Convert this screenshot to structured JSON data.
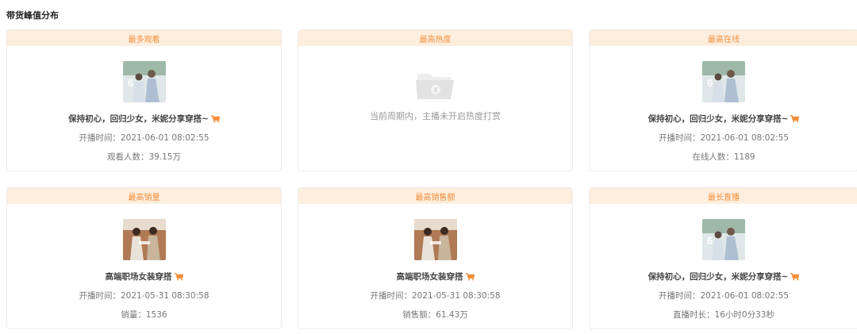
{
  "section_title": "带货峰值分布",
  "cards": [
    {
      "header": "最多观看",
      "title": "保持初心，回归少女，米妮分享穿搭~",
      "time": "开播时间：2021-06-01 08:02:55",
      "stat": "观看人数：39.15万"
    },
    {
      "header": "最高热度",
      "empty_text": "当前周期内，主播未开启热度打赏"
    },
    {
      "header": "最高在线",
      "title": "保持初心，回归少女，米妮分享穿搭~",
      "time": "开播时间：2021-06-01 08:02:55",
      "stat": "在线人数：1189"
    },
    {
      "header": "最高销量",
      "title": "高端职场女装穿搭",
      "time": "开播时间：2021-05-31 08:30:58",
      "stat": "销量：1536"
    },
    {
      "header": "最高销售额",
      "title": "高端职场女装穿搭",
      "time": "开播时间：2021-05-31 08:30:58",
      "stat": "销售额：61.43万"
    },
    {
      "header": "最长直播",
      "title": "保持初心，回归少女，米妮分享穿搭~",
      "time": "开播时间：2021-06-01 08:02:55",
      "stat": "直播时长：16小时0分33秒"
    }
  ],
  "colors": {
    "header_bg": "#fdeede",
    "header_text": "#f58f3c",
    "cart_icon": "#f58f3c"
  }
}
